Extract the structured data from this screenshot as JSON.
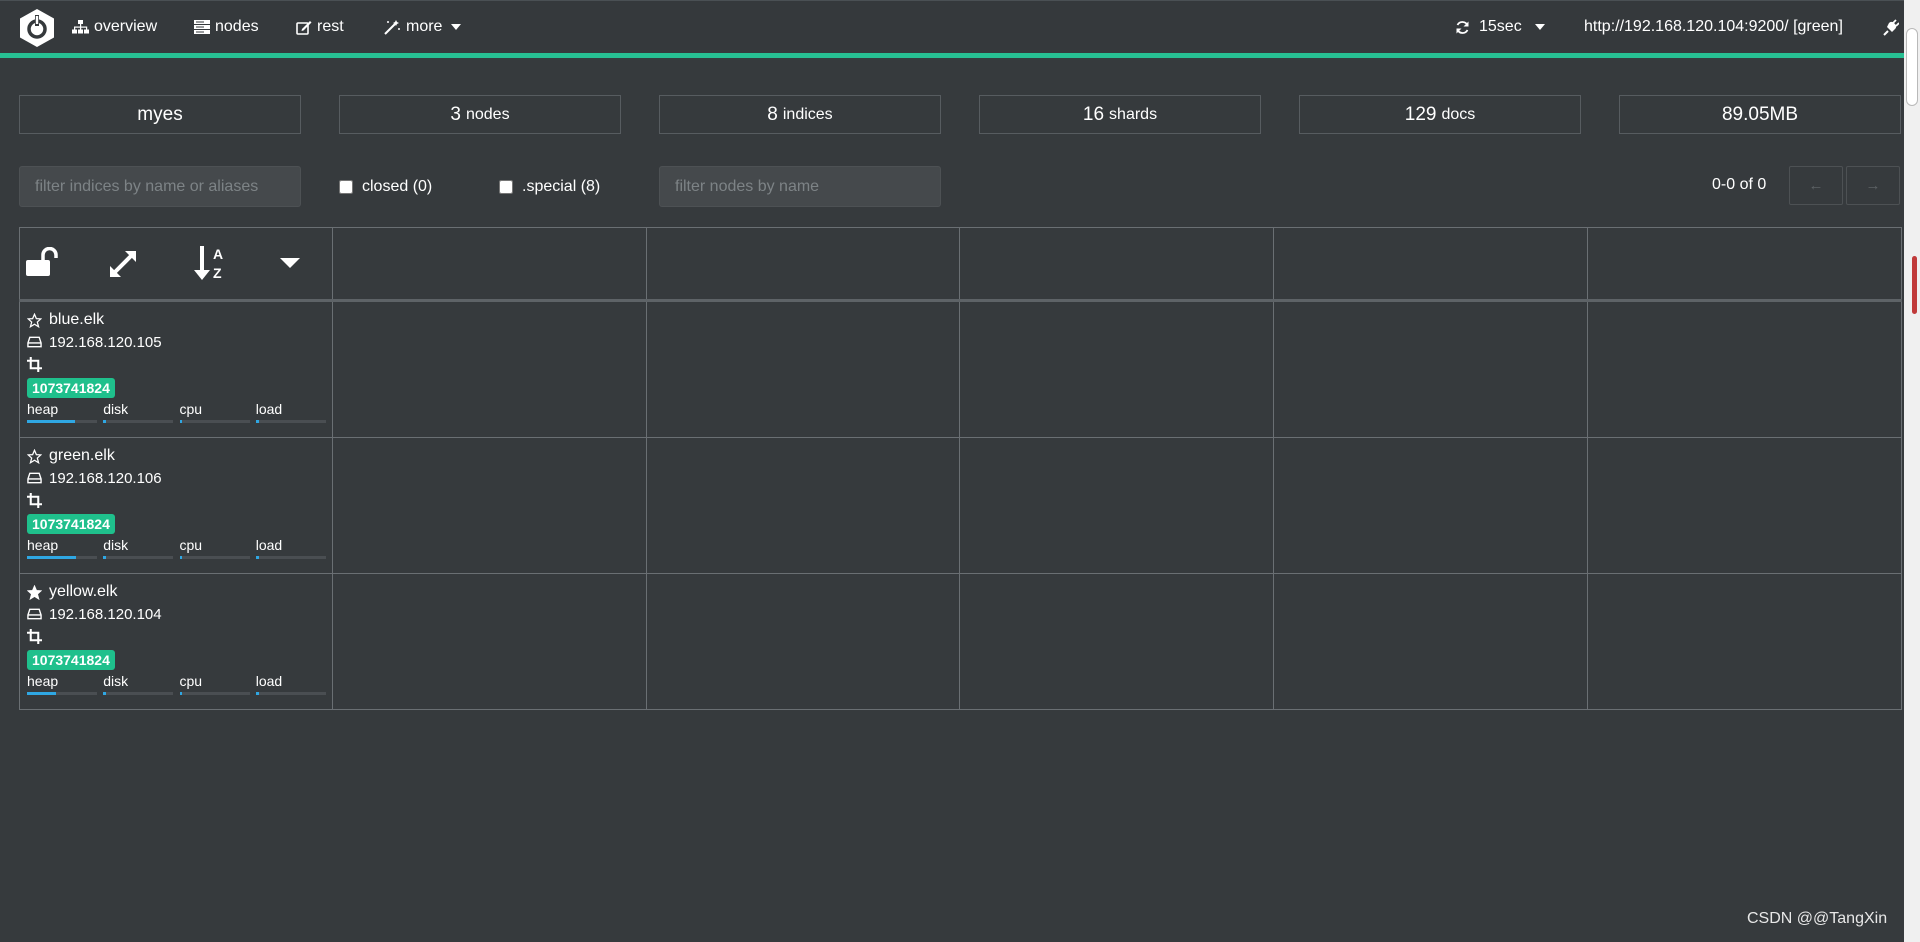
{
  "nav": {
    "overview_label": "overview",
    "nodes_label": "nodes",
    "rest_label": "rest",
    "more_label": "more",
    "refresh_label": "15sec",
    "cluster_url": "http://192.168.120.104:9200/ [green]"
  },
  "stats": {
    "cluster_name": "myes",
    "nodes_count": "3",
    "nodes_unit": "nodes",
    "indices_count": "8",
    "indices_unit": "indices",
    "shards_count": "16",
    "shards_unit": "shards",
    "docs_count": "129",
    "docs_unit": "docs",
    "size": "89.05MB"
  },
  "filters": {
    "indices_placeholder": "filter indices by name or aliases",
    "closed_label": "closed (0)",
    "special_label": ".special (8)",
    "nodes_placeholder": "filter nodes by name"
  },
  "pager": {
    "text": "0-0 of 0",
    "prev": "←",
    "next": "→"
  },
  "nodes": [
    {
      "name": "blue.elk",
      "ip": "192.168.120.105",
      "badge": "1073741824",
      "heap": "heap",
      "disk": "disk",
      "cpu": "cpu",
      "load": "load",
      "heap_pct": 0.68,
      "disk_pct": 0.04,
      "cpu_pct": 0.0,
      "load_pct": 0.03,
      "master": false
    },
    {
      "name": "green.elk",
      "ip": "192.168.120.106",
      "badge": "1073741824",
      "heap": "heap",
      "disk": "disk",
      "cpu": "cpu",
      "load": "load",
      "heap_pct": 0.7,
      "disk_pct": 0.04,
      "cpu_pct": 0.0,
      "load_pct": 0.03,
      "master": false
    },
    {
      "name": "yellow.elk",
      "ip": "192.168.120.104",
      "badge": "1073741824",
      "heap": "heap",
      "disk": "disk",
      "cpu": "cpu",
      "load": "load",
      "heap_pct": 0.42,
      "disk_pct": 0.04,
      "cpu_pct": 0.0,
      "load_pct": 0.03,
      "master": true
    }
  ],
  "watermark": "CSDN @@TangXin",
  "colors": {
    "background": "#363a3d",
    "accent": "#27c093",
    "badge": "#1fc08c",
    "heap_bar": "#2fa7e3"
  }
}
